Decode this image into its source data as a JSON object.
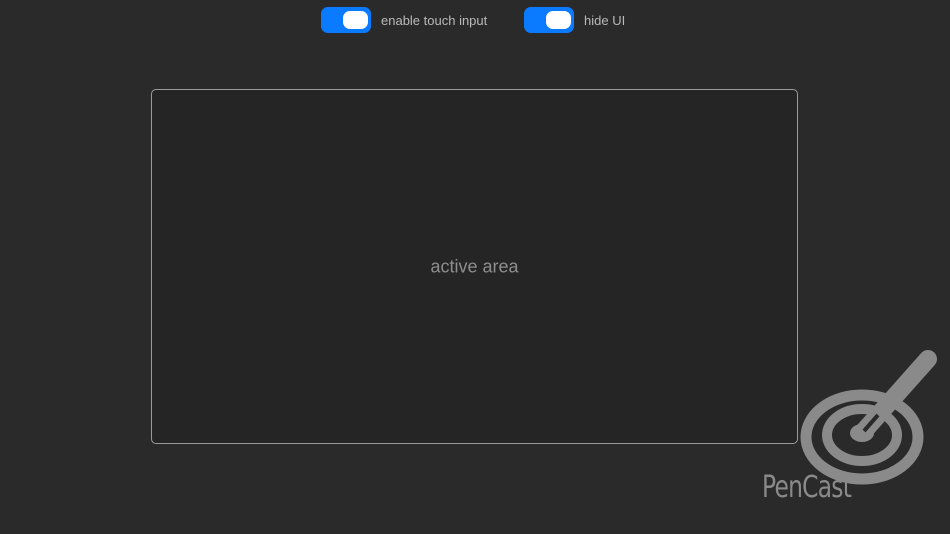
{
  "toggles": [
    {
      "label": "enable touch input",
      "state": "on"
    },
    {
      "label": "hide UI",
      "state": "on"
    }
  ],
  "active_area": {
    "label": "active area"
  },
  "logo": {
    "text": "PenCast",
    "icon": "pen-target-icon"
  },
  "colors": {
    "background": "#2a2a2a",
    "toggle_on": "#0a7bff",
    "text": "#b9b9b9",
    "logo": "#8a8a8a"
  }
}
